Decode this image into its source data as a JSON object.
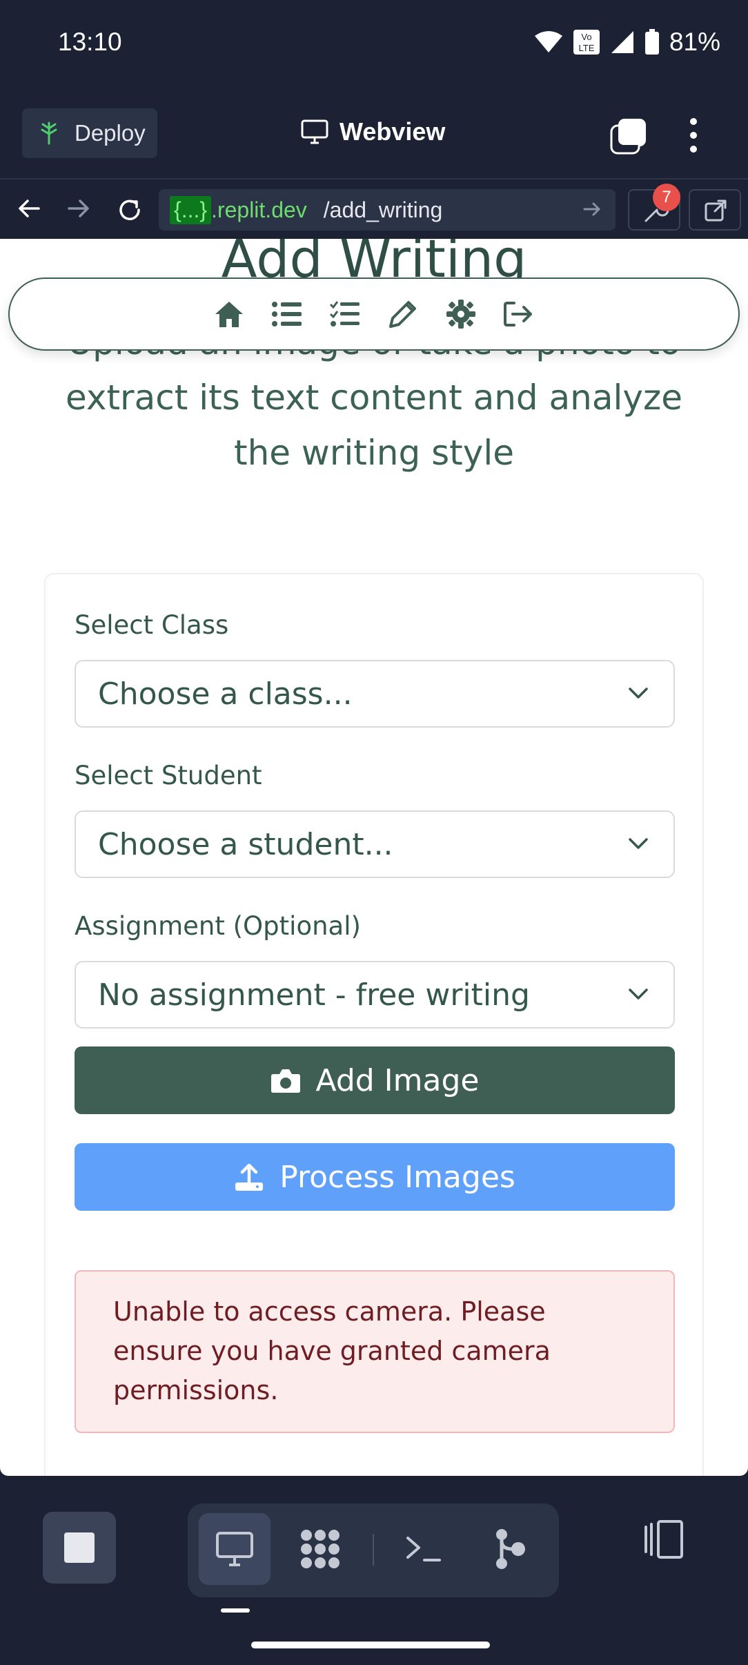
{
  "status_bar": {
    "time": "13:10",
    "battery_percent": "81%",
    "volte_label": "Vo LTE"
  },
  "top_bar": {
    "deploy_label": "Deploy",
    "webview_label": "Webview"
  },
  "url_bar": {
    "token": "{...}",
    "domain": ".replit.dev",
    "path": "/add_writing",
    "devtools_badge": "7"
  },
  "page": {
    "title": "Add Writing",
    "subtitle": "Upload an image or take a photo to extract its text content and analyze the writing style",
    "nav_icons": [
      "home-icon",
      "list-icon",
      "checklist-icon",
      "pencil-icon",
      "gear-icon",
      "logout-icon"
    ],
    "form": {
      "class_label": "Select Class",
      "class_value": "Choose a class...",
      "student_label": "Select Student",
      "student_value": "Choose a student...",
      "assignment_label": "Assignment (Optional)",
      "assignment_value": "No assignment - free writing",
      "add_image_label": "Add Image",
      "process_label": "Process Images"
    },
    "alert": "Unable to access camera. Please ensure you have granted camera permissions."
  },
  "colors": {
    "primary": "#3f5f55",
    "process": "#5fa0fb",
    "alert_bg": "#fdecec",
    "app_bg": "#1c2233"
  }
}
